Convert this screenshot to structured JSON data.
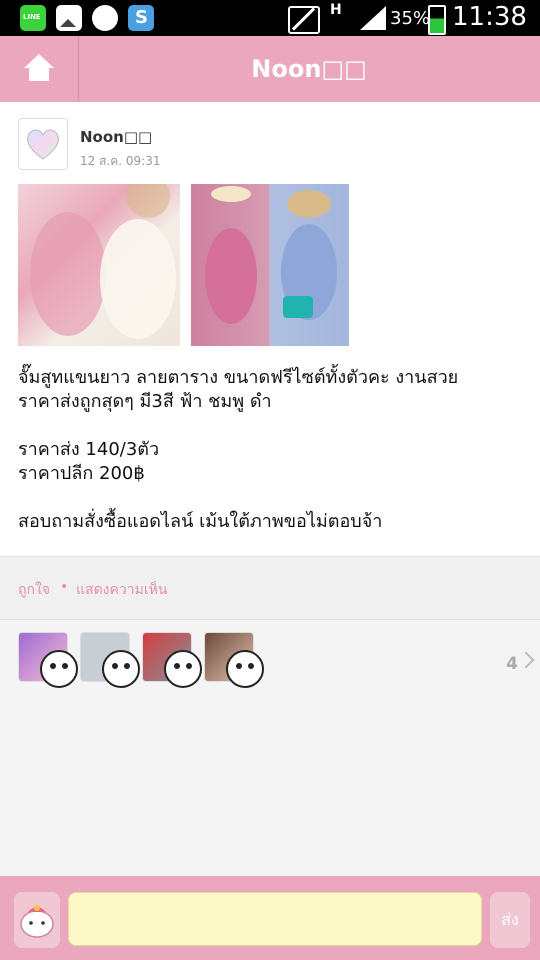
{
  "status_bar": {
    "icons": [
      "line-icon",
      "gallery-icon",
      "twitter-icon",
      "s-app-icon",
      "mute-icon",
      "h-signal-icon",
      "cell-signal-icon",
      "battery-icon"
    ],
    "network": "H",
    "battery_percent": "35%",
    "time": "11:38"
  },
  "header": {
    "title": "Noon□□",
    "home_icon": "home-icon",
    "background": "#eaa7bd"
  },
  "post": {
    "author": "Noon□□",
    "timestamp": "12 ส.ค. 09:31",
    "photos": [
      "photo-1",
      "photo-2"
    ],
    "text": "จั๊มสูทแขนยาว ลายตาราง ขนาดฟรีไซต์ทั้งตัวคะ งานสวย\nราคาส่งถูกสุดๆ มี3สี ฟ้า ชมพู ดำ\n\nราคาส่ง 140/3ตัว\nราคาปลีก 200฿\n\nสอบถามสั่งซื้อแอดไลน์ เม้นใต้ภาพขอไม่ตอบจ้า"
  },
  "actions": {
    "like_label": "ถูกใจ",
    "separator": "•",
    "comment_label": "แสดงความเห็น",
    "color": "#e68ea8"
  },
  "likers": {
    "count": "4",
    "avatars": [
      "liker-1",
      "liker-2",
      "liker-3",
      "liker-4"
    ]
  },
  "input_bar": {
    "sticker_icon": "sticker-icon",
    "message_value": "",
    "send_label": "ส่ง",
    "input_color": "#fcf8c8"
  }
}
